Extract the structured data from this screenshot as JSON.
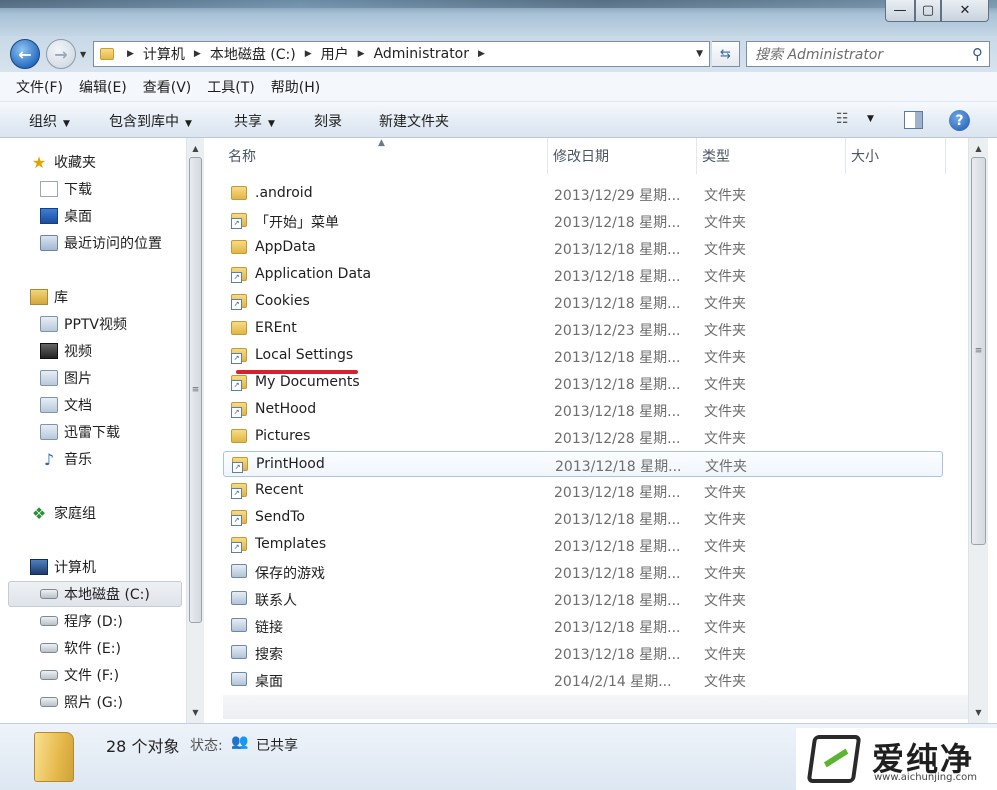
{
  "window": {
    "min_label": "—",
    "max_label": "▢",
    "close_label": "✕"
  },
  "nav": {
    "back_glyph": "←",
    "forward_glyph": "→",
    "breadcrumbs": [
      "计算机",
      "本地磁盘 (C:)",
      "用户",
      "Administrator"
    ],
    "search_placeholder": "搜索 Administrator"
  },
  "menubar": [
    "文件(F)",
    "编辑(E)",
    "查看(V)",
    "工具(T)",
    "帮助(H)"
  ],
  "toolbar": {
    "organize": "组织",
    "include_library": "包含到库中",
    "share": "共享",
    "burn": "刻录",
    "new_folder": "新建文件夹"
  },
  "sidebar": {
    "favorites": {
      "label": "收藏夹",
      "items": [
        "下载",
        "桌面",
        "最近访问的位置"
      ]
    },
    "libraries": {
      "label": "库",
      "items": [
        "PPTV视频",
        "视频",
        "图片",
        "文档",
        "迅雷下载",
        "音乐"
      ]
    },
    "homegroup": "家庭组",
    "computer": {
      "label": "计算机",
      "drives": [
        "本地磁盘 (C:)",
        "程序 (D:)",
        "软件 (E:)",
        "文件 (F:)",
        "照片 (G:)"
      ],
      "selected": "本地磁盘 (C:)"
    }
  },
  "columns": {
    "name": "名称",
    "modified": "修改日期",
    "type": "类型",
    "size": "大小"
  },
  "files": [
    {
      "name": ".android",
      "date": "2013/12/29 星期...",
      "type": "文件夹",
      "kind": "folder"
    },
    {
      "name": "「开始」菜单",
      "date": "2013/12/18 星期...",
      "type": "文件夹",
      "kind": "shortcut"
    },
    {
      "name": "AppData",
      "date": "2013/12/18 星期...",
      "type": "文件夹",
      "kind": "folder"
    },
    {
      "name": "Application Data",
      "date": "2013/12/18 星期...",
      "type": "文件夹",
      "kind": "shortcut"
    },
    {
      "name": "Cookies",
      "date": "2013/12/18 星期...",
      "type": "文件夹",
      "kind": "shortcut"
    },
    {
      "name": "EREnt",
      "date": "2013/12/23 星期...",
      "type": "文件夹",
      "kind": "folder"
    },
    {
      "name": "Local Settings",
      "date": "2013/12/18 星期...",
      "type": "文件夹",
      "kind": "shortcut"
    },
    {
      "name": "My Documents",
      "date": "2013/12/18 星期...",
      "type": "文件夹",
      "kind": "shortcut"
    },
    {
      "name": "NetHood",
      "date": "2013/12/18 星期...",
      "type": "文件夹",
      "kind": "shortcut"
    },
    {
      "name": "Pictures",
      "date": "2013/12/28 星期...",
      "type": "文件夹",
      "kind": "folder"
    },
    {
      "name": "PrintHood",
      "date": "2013/12/18 星期...",
      "type": "文件夹",
      "kind": "shortcut"
    },
    {
      "name": "Recent",
      "date": "2013/12/18 星期...",
      "type": "文件夹",
      "kind": "shortcut"
    },
    {
      "name": "SendTo",
      "date": "2013/12/18 星期...",
      "type": "文件夹",
      "kind": "shortcut"
    },
    {
      "name": "Templates",
      "date": "2013/12/18 星期...",
      "type": "文件夹",
      "kind": "shortcut"
    },
    {
      "name": "保存的游戏",
      "date": "2013/12/18 星期...",
      "type": "文件夹",
      "kind": "sys"
    },
    {
      "name": "联系人",
      "date": "2013/12/18 星期...",
      "type": "文件夹",
      "kind": "sys"
    },
    {
      "name": "链接",
      "date": "2013/12/18 星期...",
      "type": "文件夹",
      "kind": "sys"
    },
    {
      "name": "搜索",
      "date": "2013/12/18 星期...",
      "type": "文件夹",
      "kind": "sys"
    },
    {
      "name": "桌面",
      "date": "2014/2/14 星期...",
      "type": "文件夹",
      "kind": "sys"
    }
  ],
  "selected_file": "PrintHood",
  "status": {
    "count": "28 个对象",
    "state_label": "状态:",
    "state_value": "已共享"
  },
  "watermark": {
    "title": "爱纯净",
    "url": "www.aichunjing.com"
  },
  "colors": {
    "annotation_red": "#d6222f",
    "selection_border": "#a8c4e2"
  }
}
